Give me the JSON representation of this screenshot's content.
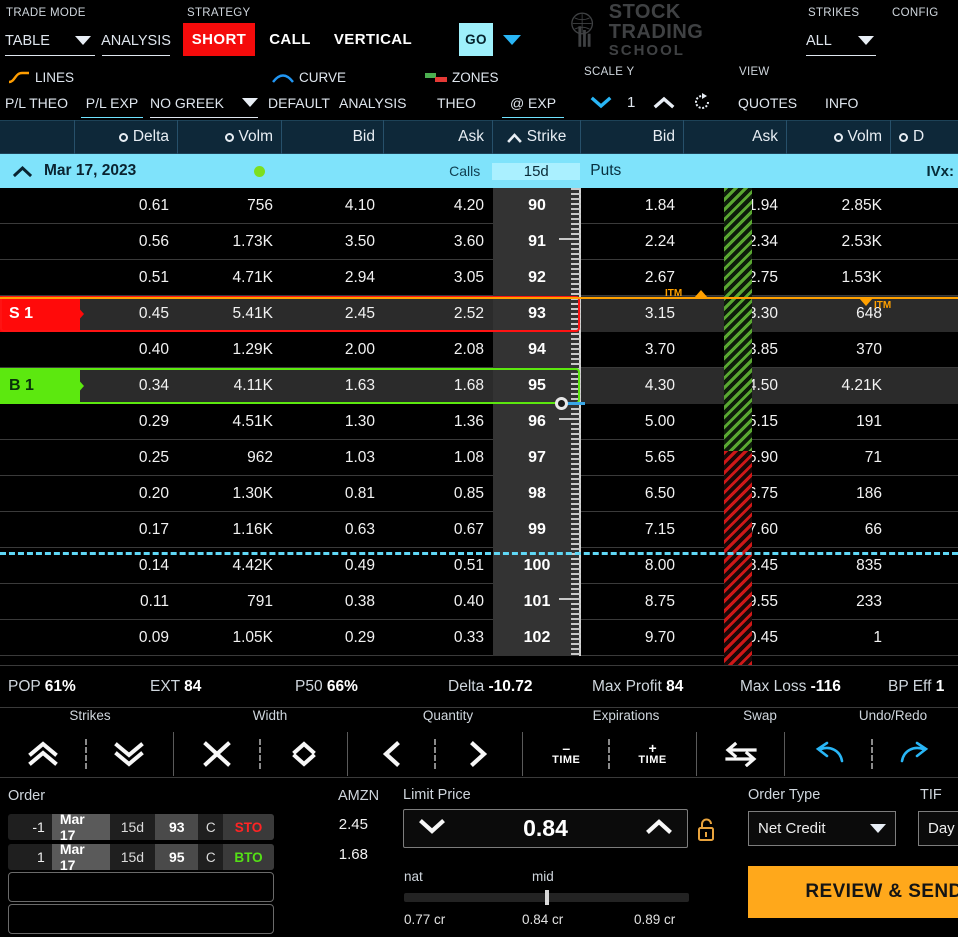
{
  "toolbar": {
    "captions": {
      "trade_mode": "TRADE MODE",
      "strategy": "STRATEGY",
      "strikes": "STRIKES",
      "config": "CONFIG",
      "scale_y": "SCALE Y",
      "view": "VIEW"
    },
    "trade_mode_value": "TABLE",
    "analysis": "ANALYSIS",
    "strategy": {
      "direction": "SHORT",
      "type": "CALL",
      "spread": "VERTICAL",
      "go": "GO"
    },
    "logo": {
      "line1": "STOCK TRADING",
      "line2": "SCHOOL"
    },
    "strikes_value": "ALL",
    "config_label": "CONFIG",
    "row2": {
      "lines": "LINES",
      "pl_theo": "P/L THEO",
      "pl_exp": "P/L EXP",
      "greek": "NO GREEK",
      "curve": "CURVE",
      "default": "DEFAULT",
      "analysis": "ANALYSIS",
      "zones": "ZONES",
      "theo": "THEO",
      "at_exp": "@ EXP",
      "scale_value": "1",
      "quotes": "QUOTES",
      "info": "INFO"
    }
  },
  "chain": {
    "headers": {
      "call_delta": "Delta",
      "call_volm": "Volm",
      "call_bid": "Bid",
      "call_ask": "Ask",
      "strike": "Strike",
      "put_bid": "Bid",
      "put_ask": "Ask",
      "put_volm": "Volm",
      "put_delta": "D"
    },
    "expiration": {
      "date": "Mar 17, 2023",
      "calls": "Calls",
      "dte": "15d",
      "puts": "Puts",
      "ivx": "IVx:"
    },
    "columns": [
      "Delta",
      "Volm",
      "Bid",
      "Ask",
      "Strike",
      "Bid",
      "Ask",
      "Volm",
      "D"
    ],
    "rows": [
      {
        "cdelta": "0.61",
        "cvolm": "756",
        "cbid": "4.10",
        "cask": "4.20",
        "strike": "90",
        "pbid": "1.84",
        "pask": "1.94",
        "pvolm": "2.85K",
        "tag": "",
        "sel": false
      },
      {
        "cdelta": "0.56",
        "cvolm": "1.73K",
        "cbid": "3.50",
        "cask": "3.60",
        "strike": "91",
        "pbid": "2.24",
        "pask": "2.34",
        "pvolm": "2.53K",
        "tag": "",
        "sel": false
      },
      {
        "cdelta": "0.51",
        "cvolm": "4.71K",
        "cbid": "2.94",
        "cask": "3.05",
        "strike": "92",
        "pbid": "2.67",
        "pask": "2.75",
        "pvolm": "1.53K",
        "tag": "",
        "sel": false
      },
      {
        "cdelta": "0.45",
        "cvolm": "5.41K",
        "cbid": "2.45",
        "cask": "2.52",
        "strike": "93",
        "pbid": "3.15",
        "pask": "3.30",
        "pvolm": "648",
        "tag": "S 1",
        "sel": true
      },
      {
        "cdelta": "0.40",
        "cvolm": "1.29K",
        "cbid": "2.00",
        "cask": "2.08",
        "strike": "94",
        "pbid": "3.70",
        "pask": "3.85",
        "pvolm": "370",
        "tag": "",
        "sel": false
      },
      {
        "cdelta": "0.34",
        "cvolm": "4.11K",
        "cbid": "1.63",
        "cask": "1.68",
        "strike": "95",
        "pbid": "4.30",
        "pask": "4.50",
        "pvolm": "4.21K",
        "tag": "B 1",
        "sel": true
      },
      {
        "cdelta": "0.29",
        "cvolm": "4.51K",
        "cbid": "1.30",
        "cask": "1.36",
        "strike": "96",
        "pbid": "5.00",
        "pask": "5.15",
        "pvolm": "191",
        "tag": "",
        "sel": false
      },
      {
        "cdelta": "0.25",
        "cvolm": "962",
        "cbid": "1.03",
        "cask": "1.08",
        "strike": "97",
        "pbid": "5.65",
        "pask": "5.90",
        "pvolm": "71",
        "tag": "",
        "sel": false
      },
      {
        "cdelta": "0.20",
        "cvolm": "1.30K",
        "cbid": "0.81",
        "cask": "0.85",
        "strike": "98",
        "pbid": "6.50",
        "pask": "6.75",
        "pvolm": "186",
        "tag": "",
        "sel": false
      },
      {
        "cdelta": "0.17",
        "cvolm": "1.16K",
        "cbid": "0.63",
        "cask": "0.67",
        "strike": "99",
        "pbid": "7.15",
        "pask": "7.60",
        "pvolm": "66",
        "tag": "",
        "sel": false
      },
      {
        "cdelta": "0.14",
        "cvolm": "4.42K",
        "cbid": "0.49",
        "cask": "0.51",
        "strike": "100",
        "pbid": "8.00",
        "pask": "8.45",
        "pvolm": "835",
        "tag": "",
        "sel": false
      },
      {
        "cdelta": "0.11",
        "cvolm": "791",
        "cbid": "0.38",
        "cask": "0.40",
        "strike": "101",
        "pbid": "8.75",
        "pask": "9.55",
        "pvolm": "233",
        "tag": "",
        "sel": false
      },
      {
        "cdelta": "0.09",
        "cvolm": "1.05K",
        "cbid": "0.29",
        "cask": "0.33",
        "strike": "102",
        "pbid": "9.70",
        "pask": "10.45",
        "pvolm": "1",
        "tag": "",
        "sel": false
      }
    ],
    "itm_label_left": "ITM",
    "itm_label_right": "ITM"
  },
  "stats": [
    {
      "label": "POP",
      "value": "61%"
    },
    {
      "label": "EXT",
      "value": "84"
    },
    {
      "label": "P50",
      "value": "66%"
    },
    {
      "label": "Delta",
      "value": "-10.72"
    },
    {
      "label": "Max Profit",
      "value": "84"
    },
    {
      "label": "Max Loss",
      "value": "-116"
    },
    {
      "label": "BP Eff",
      "value": "1"
    }
  ],
  "actions": {
    "captions": {
      "strikes": "Strikes",
      "width": "Width",
      "quantity": "Quantity",
      "expirations": "Expirations",
      "swap": "Swap",
      "undo_redo": "Undo/Redo"
    },
    "time_minus": {
      "sign": "–",
      "word": "TIME"
    },
    "time_plus": {
      "sign": "+",
      "word": "TIME"
    }
  },
  "order": {
    "title": "Order",
    "symbol": "AMZN",
    "legs": [
      {
        "qty": "-1",
        "exp": "Mar 17",
        "dte": "15d",
        "strike": "93",
        "cp": "C",
        "action": "STO",
        "price": "2.45"
      },
      {
        "qty": "1",
        "exp": "Mar 17",
        "dte": "15d",
        "strike": "95",
        "cp": "C",
        "action": "BTO",
        "price": "1.68"
      }
    ],
    "limit": {
      "label": "Limit Price",
      "value": "0.84",
      "nat_label": "nat",
      "mid_label": "mid",
      "nat_value": "0.77 cr",
      "mid_value": "0.84 cr",
      "max_value": "0.89 cr"
    },
    "order_type": {
      "label": "Order Type",
      "value": "Net Credit"
    },
    "tif": {
      "label": "TIF",
      "value": "Day"
    },
    "submit": "REVIEW & SEND"
  },
  "colors": {
    "accent_cyan": "#7fe3fb",
    "short_red": "#f50b0b",
    "buy_green": "#5ce80f",
    "itm_orange": "#ffa000",
    "send_orange": "#ffa81b"
  }
}
